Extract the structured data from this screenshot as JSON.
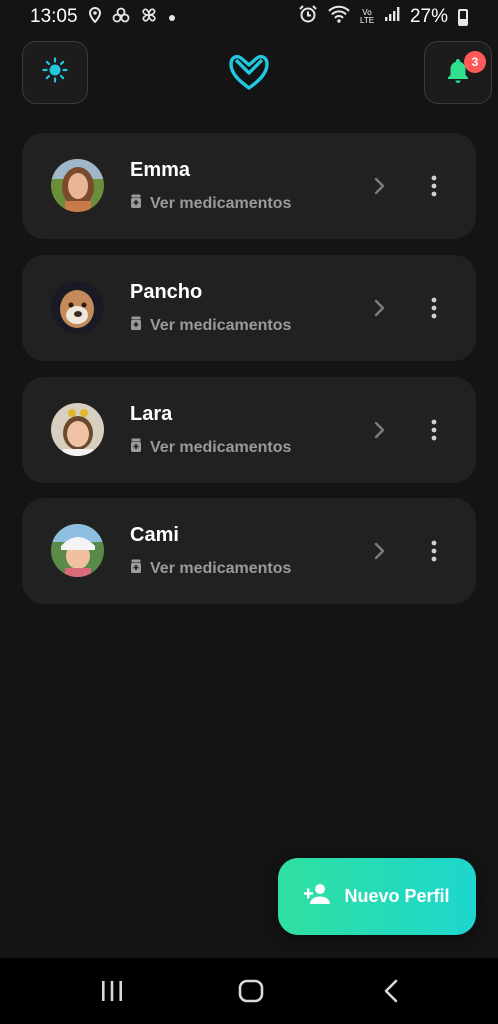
{
  "status_bar": {
    "time": "13:05",
    "battery": "27%",
    "network": "Vo LTE"
  },
  "header": {
    "notification_count": "3",
    "accent_color": "#21c9e0",
    "bell_color": "#2fe08f",
    "badge_color": "#ff5a5a"
  },
  "profiles": [
    {
      "name": "Emma",
      "action_label": "Ver medicamentos",
      "avatar": "child-photo"
    },
    {
      "name": "Pancho",
      "action_label": "Ver medicamentos",
      "avatar": "dog-photo"
    },
    {
      "name": "Lara",
      "action_label": "Ver medicamentos",
      "avatar": "child-photo"
    },
    {
      "name": "Cami",
      "action_label": "Ver medicamentos",
      "avatar": "child-photo"
    }
  ],
  "fab": {
    "label": "Nuevo Perfil",
    "icon": "person-add-icon"
  },
  "icons": {
    "theme": "sun-icon",
    "notifications": "bell-icon",
    "logo": "app-logo",
    "row_open": "chevron-right-icon",
    "row_menu": "more-vertical-icon",
    "medication": "pill-bottle-icon"
  }
}
